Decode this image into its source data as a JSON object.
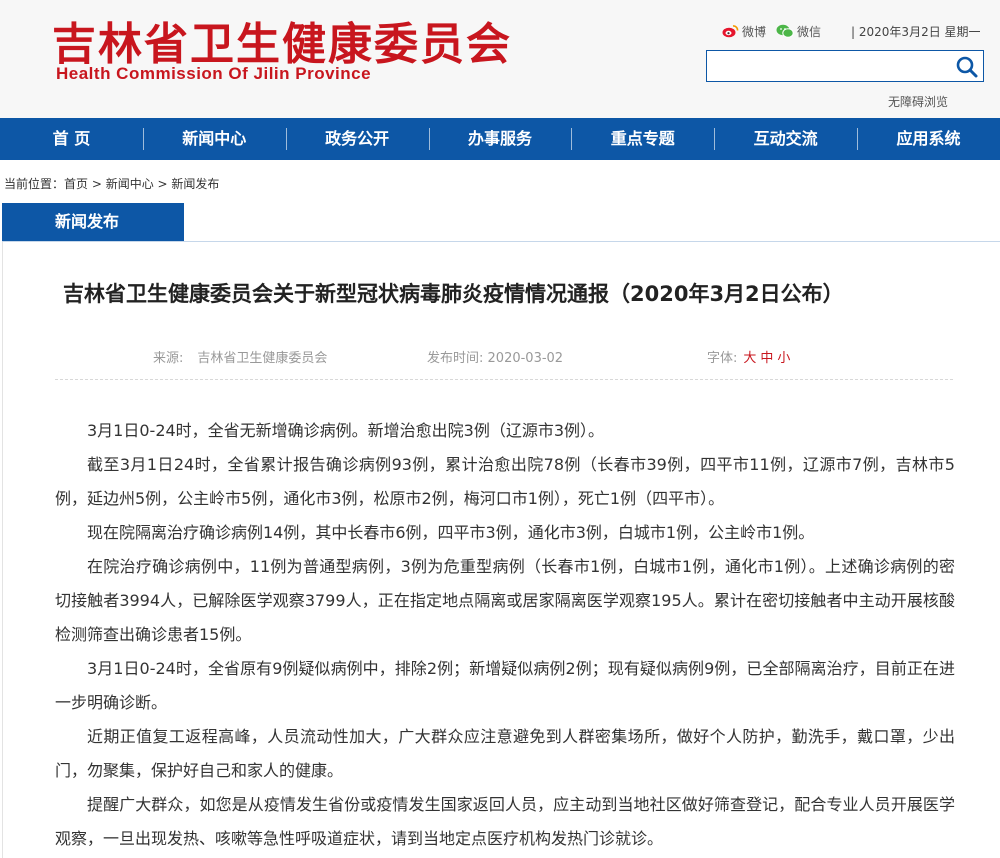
{
  "header": {
    "logo_cn": "吉林省卫生健康委员会",
    "logo_en": "Health Commission Of Jilin Province",
    "weibo": "微博",
    "wechat": "微信",
    "date": "| 2020年3月2日 星期一",
    "search_placeholder": "",
    "accessible": "无障碍浏览",
    "brand_color": "#c8161e",
    "nav_color": "#0d57a6"
  },
  "nav": {
    "items": [
      "首 页",
      "新闻中心",
      "政务公开",
      "办事服务",
      "重点专题",
      "互动交流",
      "应用系统"
    ]
  },
  "breadcrumb": {
    "prefix": "当前位置：",
    "home": "首页",
    "sep1": " > ",
    "news": "新闻中心",
    "sep2": " > ",
    "current": "新闻发布"
  },
  "section": {
    "tab": "新闻发布"
  },
  "article": {
    "title": "吉林省卫生健康委员会关于新型冠状病毒肺炎疫情情况通报（2020年3月2日公布）",
    "source_label": "来源:",
    "source_value": "吉林省卫生健康委员会",
    "time_label": "发布时间:",
    "time_value": "2020-03-02",
    "font_label": "字体:",
    "font_large": "大",
    "font_medium": "中",
    "font_small": "小",
    "paragraphs": [
      "3月1日0-24时，全省无新增确诊病例。新增治愈出院3例（辽源市3例）。",
      "截至3月1日24时，全省累计报告确诊病例93例，累计治愈出院78例（长春市39例，四平市11例，辽源市7例，吉林市5例，延边州5例，公主岭市5例，通化市3例，松原市2例，梅河口市1例），死亡1例（四平市）。",
      "现在院隔离治疗确诊病例14例，其中长春市6例，四平市3例，通化市3例，白城市1例，公主岭市1例。",
      "在院治疗确诊病例中，11例为普通型病例，3例为危重型病例（长春市1例，白城市1例，通化市1例）。上述确诊病例的密切接触者3994人，已解除医学观察3799人，正在指定地点隔离或居家隔离医学观察195人。累计在密切接触者中主动开展核酸检测筛查出确诊患者15例。",
      "3月1日0-24时，全省原有9例疑似病例中，排除2例；新增疑似病例2例；现有疑似病例9例，已全部隔离治疗，目前正在进一步明确诊断。",
      "近期正值复工返程高峰，人员流动性加大，广大群众应注意避免到人群密集场所，做好个人防护，勤洗手，戴口罩，少出门，勿聚集，保护好自己和家人的健康。",
      "提醒广大群众，如您是从疫情发生省份或疫情发生国家返回人员，应主动到当地社区做好筛查登记，配合专业人员开展医学观察，一旦出现发热、咳嗽等急性呼吸道症状，请到当地定点医疗机构发热门诊就诊。"
    ]
  }
}
